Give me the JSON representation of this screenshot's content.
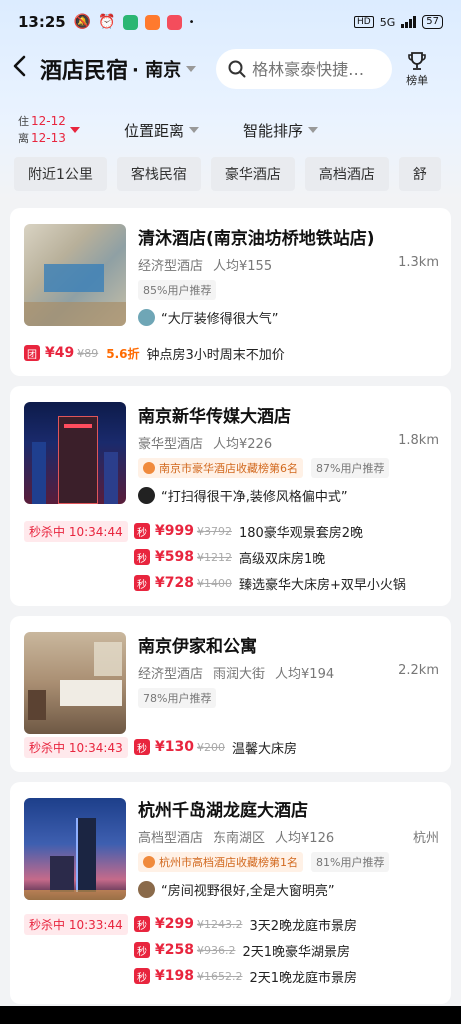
{
  "status_bar": {
    "time": "13:25",
    "network": "5G",
    "battery": "57"
  },
  "header": {
    "title": "酒店民宿",
    "city": "· 南京",
    "search_placeholder": "格林豪泰快捷…",
    "rank_label": "榜单"
  },
  "filters": {
    "checkin_prefix": "住",
    "checkin": "12-12",
    "checkout_prefix": "离",
    "checkout": "12-13",
    "location": "位置距离",
    "sort": "智能排序"
  },
  "chips": [
    "附近1公里",
    "客栈民宿",
    "豪华酒店",
    "高档酒店",
    "舒"
  ],
  "hotels": [
    {
      "name": "清沐酒店(南京油坊桥地铁站店)",
      "type": "经济型酒店",
      "avg": "人均¥155",
      "distance": "1.3km",
      "tags": [
        "85%用户推荐"
      ],
      "review": "“大厅装修得很大气”",
      "deal": {
        "badge": "团",
        "price": "¥49",
        "orig": "¥89",
        "discount": "5.6折",
        "desc": "钟点房3小时周末不加价"
      }
    },
    {
      "name": "南京新华传媒大酒店",
      "type": "豪华型酒店",
      "avg": "人均¥226",
      "distance": "1.8km",
      "rank_tag": "南京市豪华酒店收藏榜第6名",
      "tags": [
        "87%用户推荐"
      ],
      "review": "“打扫得很干净,装修风格偏中式”",
      "flash": "秒杀中 10:34:44",
      "offers": [
        {
          "badge": "秒",
          "price": "¥999",
          "orig": "¥3792",
          "desc": "180豪华观景套房2晚"
        },
        {
          "badge": "秒",
          "price": "¥598",
          "orig": "¥1212",
          "desc": "高级双床房1晚"
        },
        {
          "badge": "秒",
          "price": "¥728",
          "orig": "¥1400",
          "desc": "臻选豪华大床房+双早小火锅"
        }
      ]
    },
    {
      "name": "南京伊家和公寓",
      "type": "经济型酒店",
      "area": "雨润大街",
      "avg": "人均¥194",
      "distance": "2.2km",
      "tags": [
        "78%用户推荐"
      ],
      "flash": "秒杀中 10:34:43",
      "offers": [
        {
          "badge": "秒",
          "price": "¥130",
          "orig": "¥200",
          "desc": "温馨大床房"
        }
      ]
    },
    {
      "name": "杭州千岛湖龙庭大酒店",
      "type": "高档型酒店",
      "area": "东南湖区",
      "avg": "人均¥126",
      "distance": "杭州",
      "rank_tag": "杭州市高档酒店收藏榜第1名",
      "tags": [
        "81%用户推荐"
      ],
      "review": "“房间视野很好,全是大窗明亮”",
      "flash": "秒杀中 10:33:44",
      "offers": [
        {
          "badge": "秒",
          "price": "¥299",
          "orig": "¥1243.2",
          "desc": "3天2晚龙庭市景房"
        },
        {
          "badge": "秒",
          "price": "¥258",
          "orig": "¥936.2",
          "desc": "2天1晚豪华湖景房"
        },
        {
          "badge": "秒",
          "price": "¥198",
          "orig": "¥1652.2",
          "desc": "2天1晚龙庭市景房"
        }
      ]
    }
  ]
}
